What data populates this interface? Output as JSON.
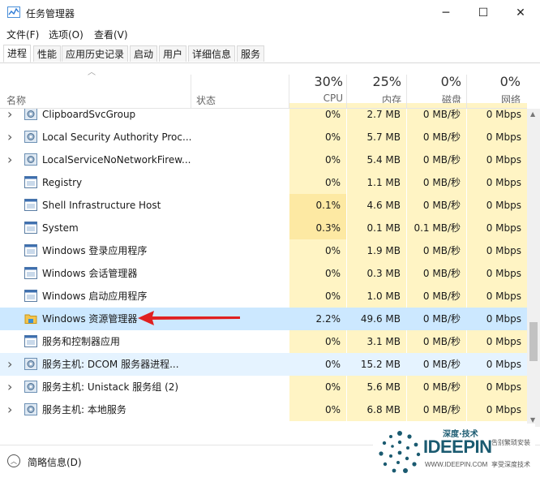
{
  "window": {
    "title": "任务管理器"
  },
  "controls": {
    "minimize": "─",
    "maximize": "☐",
    "close": "✕"
  },
  "menu": [
    "文件(F)",
    "选项(O)",
    "查看(V)"
  ],
  "tabs": [
    "进程",
    "性能",
    "应用历史记录",
    "启动",
    "用户",
    "详细信息",
    "服务"
  ],
  "active_tab": "进程",
  "columns": {
    "name": "名称",
    "status": "状态",
    "cpu": {
      "pct": "30%",
      "label": "CPU"
    },
    "mem": {
      "pct": "25%",
      "label": "内存"
    },
    "disk": {
      "pct": "0%",
      "label": "磁盘"
    },
    "net": {
      "pct": "0%",
      "label": "网络"
    }
  },
  "processes": [
    {
      "name": "ClipboardSvcGroup",
      "cpu": "0%",
      "mem": "2.7 MB",
      "disk": "0 MB/秒",
      "net": "0 Mbps",
      "expandable": true,
      "icon": "gear-icon"
    },
    {
      "name": "Local Security Authority Proc...",
      "cpu": "0%",
      "mem": "5.7 MB",
      "disk": "0 MB/秒",
      "net": "0 Mbps",
      "expandable": true,
      "icon": "gear-icon"
    },
    {
      "name": "LocalServiceNoNetworkFirew...",
      "cpu": "0%",
      "mem": "5.4 MB",
      "disk": "0 MB/秒",
      "net": "0 Mbps",
      "expandable": true,
      "icon": "gear-icon"
    },
    {
      "name": "Registry",
      "cpu": "0%",
      "mem": "1.1 MB",
      "disk": "0 MB/秒",
      "net": "0 Mbps",
      "expandable": false,
      "icon": "window-icon"
    },
    {
      "name": "Shell Infrastructure Host",
      "cpu": "0.1%",
      "mem": "4.6 MB",
      "disk": "0 MB/秒",
      "net": "0 Mbps",
      "expandable": false,
      "icon": "window-icon"
    },
    {
      "name": "System",
      "cpu": "0.3%",
      "mem": "0.1 MB",
      "disk": "0.1 MB/秒",
      "net": "0 Mbps",
      "expandable": false,
      "icon": "window-icon"
    },
    {
      "name": "Windows 登录应用程序",
      "cpu": "0%",
      "mem": "1.9 MB",
      "disk": "0 MB/秒",
      "net": "0 Mbps",
      "expandable": false,
      "icon": "window-icon"
    },
    {
      "name": "Windows 会话管理器",
      "cpu": "0%",
      "mem": "0.3 MB",
      "disk": "0 MB/秒",
      "net": "0 Mbps",
      "expandable": false,
      "icon": "window-icon"
    },
    {
      "name": "Windows 启动应用程序",
      "cpu": "0%",
      "mem": "1.0 MB",
      "disk": "0 MB/秒",
      "net": "0 Mbps",
      "expandable": false,
      "icon": "window-icon"
    },
    {
      "name": "Windows 资源管理器",
      "cpu": "2.2%",
      "mem": "49.6 MB",
      "disk": "0 MB/秒",
      "net": "0 Mbps",
      "expandable": false,
      "icon": "folder-icon",
      "selected": true
    },
    {
      "name": "服务和控制器应用",
      "cpu": "0%",
      "mem": "3.1 MB",
      "disk": "0 MB/秒",
      "net": "0 Mbps",
      "expandable": false,
      "icon": "window-icon"
    },
    {
      "name": "服务主机: DCOM 服务器进程...",
      "cpu": "0%",
      "mem": "15.2 MB",
      "disk": "0 MB/秒",
      "net": "0 Mbps",
      "expandable": true,
      "icon": "gear-icon",
      "hover": true
    },
    {
      "name": "服务主机: Unistack 服务组 (2)",
      "cpu": "0%",
      "mem": "5.6 MB",
      "disk": "0 MB/秒",
      "net": "0 Mbps",
      "expandable": true,
      "icon": "gear-icon"
    },
    {
      "name": "服务主机: 本地服务",
      "cpu": "0%",
      "mem": "6.8 MB",
      "disk": "0 MB/秒",
      "net": "0 Mbps",
      "expandable": true,
      "icon": "gear-icon"
    }
  ],
  "footer": {
    "label": "简略信息(D)"
  },
  "watermark": {
    "brand": "IDEEPIN",
    "cn_title": "深度·技术",
    "tag1": "告别繁琐安装",
    "tag2": "享受深度技术",
    "url": "WWW.IDEEPIN.COM"
  },
  "colors": {
    "heat_light": "#fff4c4",
    "heat_medium": "#fde9a3",
    "selection": "#cce8ff",
    "hover": "#e5f3ff",
    "arrow": "#e02020"
  }
}
